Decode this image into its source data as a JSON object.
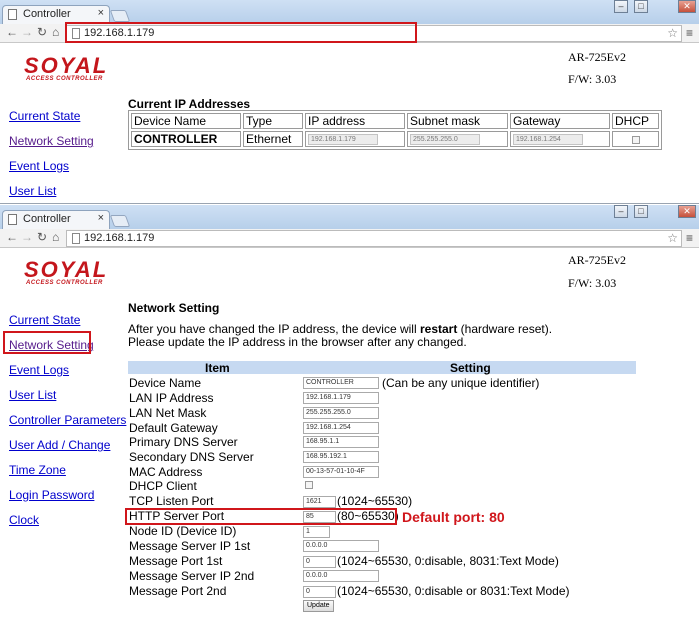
{
  "browser": {
    "tab_title": "Controller",
    "tab_close": "×",
    "url": "192.168.1.179",
    "window_controls": [
      "–",
      "□",
      "✕"
    ]
  },
  "logo": {
    "brand": "SOYAL",
    "tagline": "ACCESS CONTROLLER"
  },
  "device": {
    "model": "AR-725Ev2",
    "firmware": "F/W: 3.03"
  },
  "top_sidebar": [
    "Current State",
    "Network Setting",
    "Event Logs",
    "User List"
  ],
  "current_ip": {
    "title": "Current IP Addresses",
    "headers": [
      "Device Name",
      "Type",
      "IP address",
      "Subnet mask",
      "Gateway",
      "DHCP"
    ],
    "row": {
      "name": "CONTROLLER",
      "type": "Ethernet",
      "ip": "192.168.1.179",
      "mask": "255.255.255.0",
      "gateway": "192.168.1.254"
    }
  },
  "bottom_sidebar": [
    "Current State",
    "Network Setting",
    "Event Logs",
    "User List",
    "Controller Parameters",
    "User Add / Change",
    "Time Zone",
    "Login Password",
    "Clock"
  ],
  "network": {
    "title": "Network Setting",
    "intro_pre": "After you have changed the IP address, the device will ",
    "intro_bold": "restart",
    "intro_post": " (hardware reset).",
    "intro_line2": "Please update the IP address in the browser after any changed.",
    "col_item": "Item",
    "col_setting": "Setting",
    "rows": [
      {
        "label": "Device Name",
        "value": "CONTROLLER",
        "note": "(Can be any unique identifier)"
      },
      {
        "label": "LAN IP Address",
        "value": "192.168.1.179",
        "note": ""
      },
      {
        "label": "LAN Net Mask",
        "value": "255.255.255.0",
        "note": ""
      },
      {
        "label": "Default Gateway",
        "value": "192.168.1.254",
        "note": ""
      },
      {
        "label": "Primary DNS Server",
        "value": "168.95.1.1",
        "note": ""
      },
      {
        "label": "Secondary DNS Server",
        "value": "168.95.192.1",
        "note": ""
      },
      {
        "label": "MAC Address",
        "value": "00-13-57-01-10-4F",
        "note": ""
      },
      {
        "label": "DHCP Client",
        "value": "",
        "note": ""
      },
      {
        "label": "TCP Listen Port",
        "value": "1621",
        "note": "(1024~65530)"
      },
      {
        "label": "HTTP Server Port",
        "value": "85",
        "note": "(80~65530)"
      },
      {
        "label": "Node ID (Device ID)",
        "value": "1",
        "note": ""
      },
      {
        "label": "Message Server IP 1st",
        "value": "0.0.0.0",
        "note": ""
      },
      {
        "label": "Message Port 1st",
        "value": "0",
        "note": "(1024~65530, 0:disable,  8031:Text Mode)"
      },
      {
        "label": "Message Server IP 2nd",
        "value": "0.0.0.0",
        "note": ""
      },
      {
        "label": "Message Port 2nd",
        "value": "0",
        "note": "(1024~65530, 0:disable or 8031:Text Mode)"
      }
    ],
    "update_button": "Update",
    "callout": "Default port: 80"
  }
}
